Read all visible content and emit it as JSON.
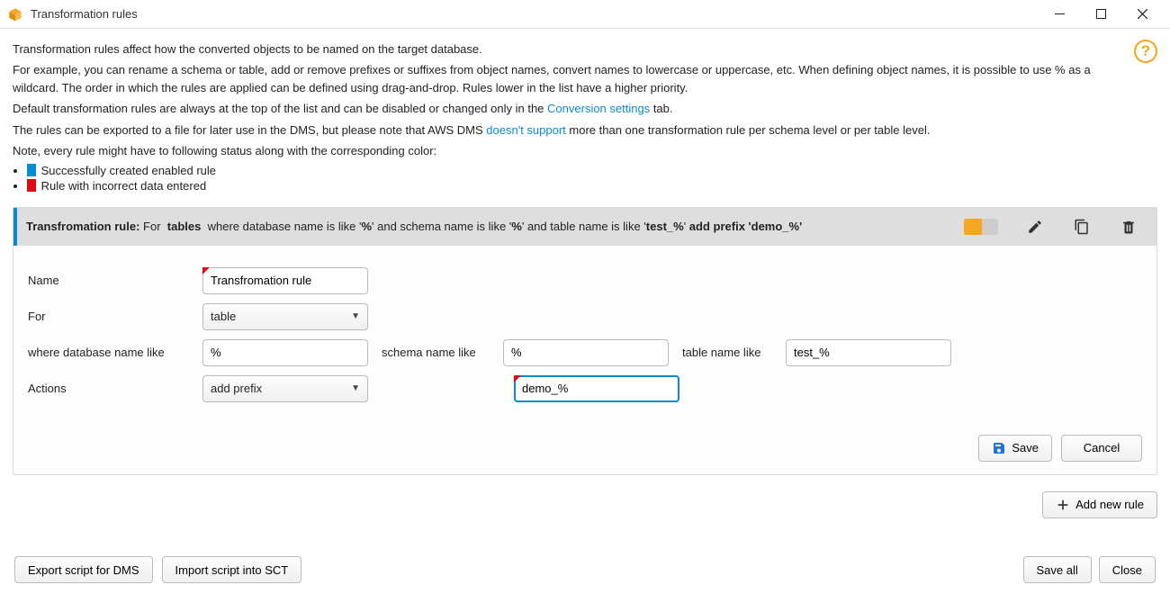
{
  "titlebar": {
    "title": "Transformation rules"
  },
  "help": {
    "tooltip": "Help"
  },
  "intro": {
    "p1": "Transformation rules affect how the converted objects to be named on the target database.",
    "p2a": "For example, you can rename a schema or table, add or remove prefixes or suffixes from object names, convert names to lowercase or uppercase, etc. When defining object names, it is possible to use % as a wildcard. The order in which the rules are applied can be defined using drag-and-drop. Rules lower in the list have a higher priority.",
    "p3a": "Default transformation rules are always at the top of the list and can be disabled or changed only in the ",
    "p3link": "Conversion settings",
    "p3b": "  tab.",
    "p4a": "The rules can be exported to a file for later use in the DMS, but please note that AWS DMS ",
    "p4link": "doesn't support",
    "p4b": "  more than one transformation rule per schema level or per table level.",
    "p5": "Note, every rule might have to following status along with the corresponding color:",
    "li1": "Successfully created enabled rule",
    "li2": "Rule with incorrect data entered"
  },
  "rule": {
    "summary_name": "Transfromation rule:",
    "summary_for_label": "For",
    "summary_for_value": "tables",
    "summary_mid1": "where database name is like '",
    "db_like": "%",
    "summary_mid2": "' and schema name is like '",
    "schema_like": "%",
    "summary_mid3": "' and table name is like '",
    "table_like": "test_%",
    "summary_action_pre": "' ",
    "summary_action": "add prefix 'demo_%'",
    "form": {
      "name_label": "Name",
      "name_value": "Transfromation rule",
      "for_label": "For",
      "for_value": "table",
      "where_db_label": "where database name like",
      "where_db_value": "%",
      "schema_label": "schema name like",
      "schema_value": "%",
      "table_label": "table name like",
      "table_value": "test_%",
      "actions_label": "Actions",
      "actions_value": "add prefix",
      "action_param": "demo_%"
    },
    "buttons": {
      "save": "Save",
      "cancel": "Cancel"
    }
  },
  "footer": {
    "add_new_rule": "Add new rule",
    "export": "Export script for DMS",
    "import": "Import script into SCT",
    "save_all": "Save all",
    "close": "Close"
  }
}
